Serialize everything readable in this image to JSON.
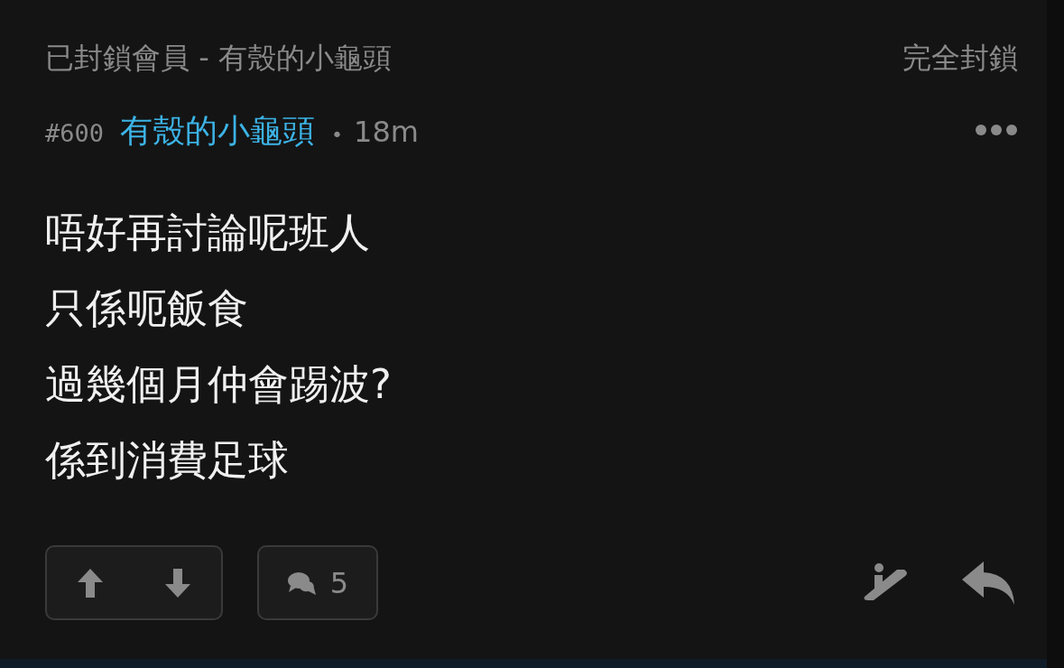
{
  "blocked_banner": {
    "label": "已封鎖會員 - 有殼的小龜頭",
    "action": "完全封鎖"
  },
  "post": {
    "number": "#600",
    "author": "有殼的小龜頭",
    "separator": "•",
    "time": "18m",
    "lines": [
      "唔好再討論呢班人",
      "只係呃飯食",
      "過幾個月仲會踢波?",
      "係到消費足球"
    ],
    "comment_count": "5"
  }
}
